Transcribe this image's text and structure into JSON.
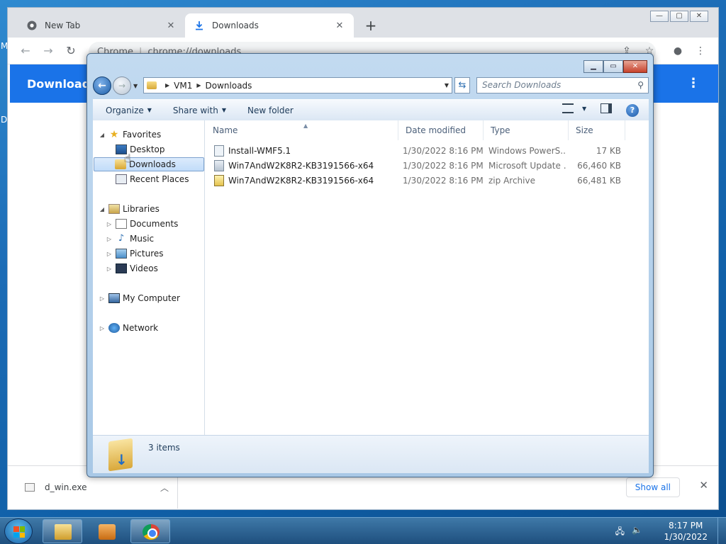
{
  "desktop": {
    "edge_letter_top": "M",
    "edge_letter_mid": "D"
  },
  "chrome": {
    "tabs": [
      {
        "title": "New Tab",
        "icon": "chrome-icon"
      },
      {
        "title": "Downloads",
        "icon": "download-icon"
      }
    ],
    "omnibox": {
      "site": "Chrome",
      "url": "chrome://downloads"
    },
    "page_title": "Downloads",
    "shelf": {
      "filename": "d_win.exe",
      "show_all": "Show all"
    }
  },
  "explorer": {
    "breadcrumb": [
      "VM1",
      "Downloads"
    ],
    "search_placeholder": "Search Downloads",
    "commands": {
      "organize": "Organize",
      "share_with": "Share with",
      "new_folder": "New folder"
    },
    "nav": {
      "favorites": "Favorites",
      "desktop": "Desktop",
      "downloads": "Downloads",
      "recent_places": "Recent Places",
      "libraries": "Libraries",
      "documents": "Documents",
      "music": "Music",
      "pictures": "Pictures",
      "videos": "Videos",
      "my_computer": "My Computer",
      "network": "Network"
    },
    "columns": {
      "name": "Name",
      "date_modified": "Date modified",
      "type": "Type",
      "size": "Size"
    },
    "files": [
      {
        "name": "Install-WMF5.1",
        "date": "1/30/2022 8:16 PM",
        "type": "Windows PowerS...",
        "size": "17 KB"
      },
      {
        "name": "Win7AndW2K8R2-KB3191566-x64",
        "date": "1/30/2022 8:16 PM",
        "type": "Microsoft Update ...",
        "size": "66,460 KB"
      },
      {
        "name": "Win7AndW2K8R2-KB3191566-x64",
        "date": "1/30/2022 8:16 PM",
        "type": "zip Archive",
        "size": "66,481 KB"
      }
    ],
    "item_count": "3 items"
  },
  "taskbar": {
    "time": "8:17 PM",
    "date": "1/30/2022"
  }
}
